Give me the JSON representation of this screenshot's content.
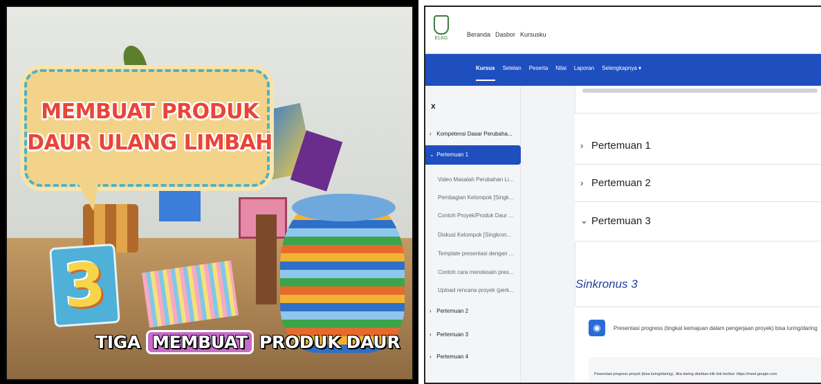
{
  "video": {
    "title_line1": "MEMBUAT PRODUK",
    "title_line2": "DAUR ULANG LIMBAH",
    "number": "3",
    "caption_left": "TIGA",
    "caption_highlight": "MEMBUAT",
    "caption_right": "PRODUK DAUR"
  },
  "lms": {
    "logo_text": "ELKG",
    "top_nav": [
      "Beranda",
      "Dasbor",
      "Kursusku"
    ],
    "course_nav": [
      {
        "label": "Kursus",
        "active": true
      },
      {
        "label": "Setelan",
        "active": false
      },
      {
        "label": "Peserta",
        "active": false
      },
      {
        "label": "Nilai",
        "active": false
      },
      {
        "label": "Laporan",
        "active": false
      },
      {
        "label": "Selengkapnya ▾",
        "active": false
      }
    ],
    "sidebar": {
      "close": "x",
      "items": [
        {
          "label": "Kompetensi Dasar Perubaha...",
          "chevron": "›"
        },
        {
          "label": "Pertemuan 1",
          "chevron": "⌄"
        },
        {
          "label": "Pertemuan 2",
          "chevron": "›"
        },
        {
          "label": "Pertemuan 3",
          "chevron": "›"
        },
        {
          "label": "Pertemuan 4",
          "chevron": "›"
        }
      ],
      "sub_items": [
        "Video Masalah Perubahan Li...",
        "Pembagian Kelompok [Singk...",
        "Contoh Proyek/Produk Daur ...",
        "Diskusi Kelompok [Singkron...",
        "Template presentasi dengan ...",
        "Contoh cara mendesain pres...",
        "Upload rencana proyek (perk..."
      ]
    },
    "sections": [
      {
        "label": "Pertemuan 1",
        "chevron": "›"
      },
      {
        "label": "Pertemuan 2",
        "chevron": "›"
      },
      {
        "label": "Pertemuan 3",
        "chevron": "⌄"
      }
    ],
    "sync_title": "Sinkronus 3",
    "activity_label": "Presentasi progress (tingkat kemajuan dalam pengerjaan proyek) bisa luring/daring",
    "activity_icon": "globe-icon",
    "description": "Presentasi progress proyek (bisa luring/daring). Jika daring silahkan klik link berikut: https://meet.google.com"
  }
}
